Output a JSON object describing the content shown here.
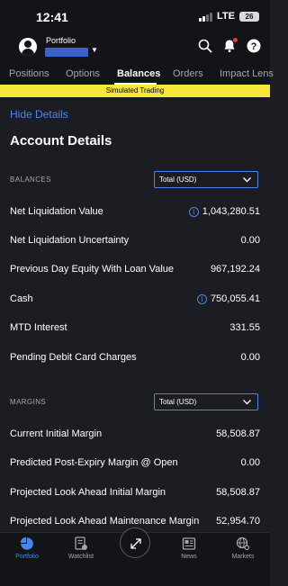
{
  "status_bar": {
    "time": "12:41",
    "network": "LTE",
    "battery": "26"
  },
  "header": {
    "portfolio_label": "Portfolio"
  },
  "tabs": [
    {
      "label": "Positions"
    },
    {
      "label": "Options"
    },
    {
      "label": "Balances"
    },
    {
      "label": "Orders"
    },
    {
      "label": "Impact Lens"
    }
  ],
  "banner": "Simulated Trading",
  "hide_details": "Hide Details",
  "page_title": "Account Details",
  "balances": {
    "section_label": "BALANCES",
    "select_value": "Total (USD)",
    "rows": [
      {
        "label": "Net Liquidation Value",
        "value": "1,043,280.51"
      },
      {
        "label": "Net Liquidation Uncertainty",
        "value": "0.00"
      },
      {
        "label": "Previous Day Equity With Loan Value",
        "value": "967,192.24"
      },
      {
        "label": "Cash",
        "value": "750,055.41"
      },
      {
        "label": "MTD Interest",
        "value": "331.55"
      },
      {
        "label": "Pending Debit Card Charges",
        "value": "0.00"
      }
    ]
  },
  "margins": {
    "section_label": "MARGINS",
    "select_value": "Total (USD)",
    "rows": [
      {
        "label": "Current Initial Margin",
        "value": "58,508.87"
      },
      {
        "label": "Predicted Post-Expiry Margin @ Open",
        "value": "0.00"
      },
      {
        "label": "Projected Look Ahead Initial Margin",
        "value": "58,508.87"
      },
      {
        "label": "Projected Look Ahead Maintenance Margin",
        "value": "52,954.70"
      }
    ]
  },
  "bottom_nav": [
    {
      "label": "Portfolio"
    },
    {
      "label": "Watchlist"
    },
    {
      "label": "News"
    },
    {
      "label": "Markets"
    }
  ],
  "colors": {
    "accent": "#4a86e8",
    "banner": "#f5e83b",
    "background": "#1c1d22"
  }
}
